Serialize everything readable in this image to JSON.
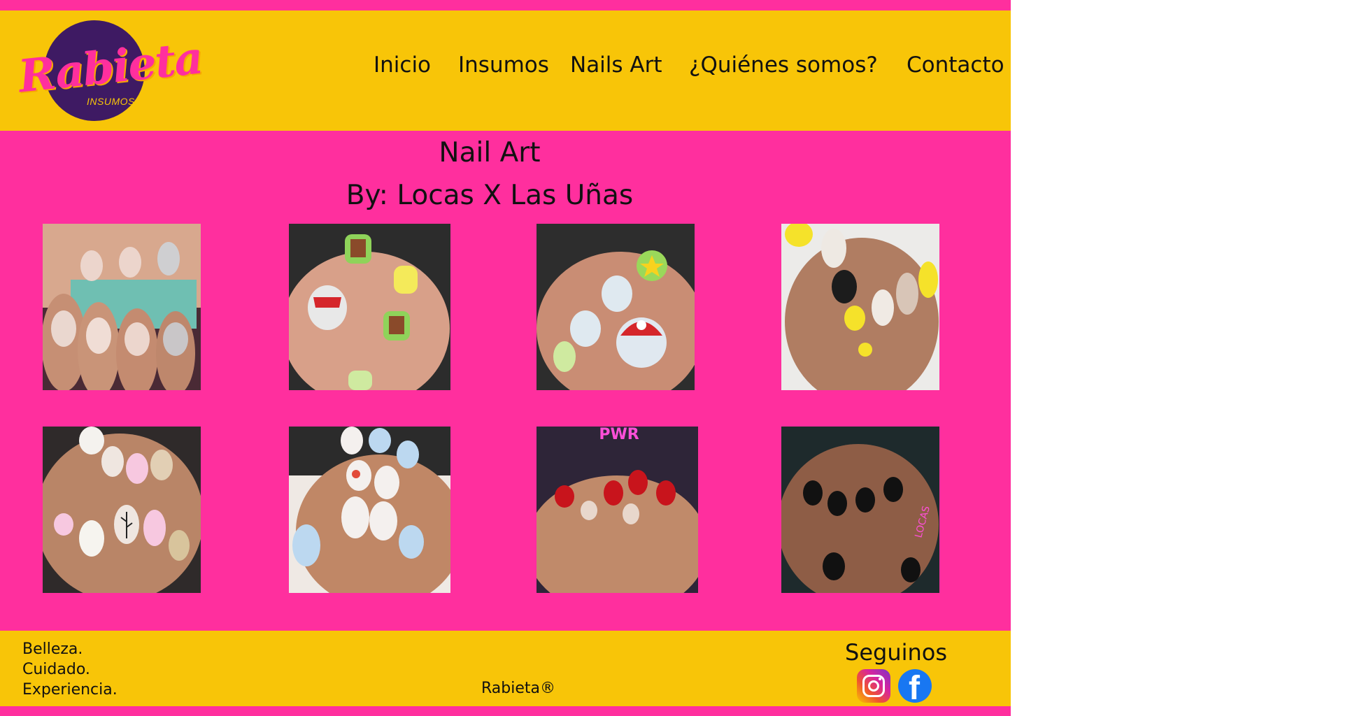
{
  "logo": {
    "text": "Rabieta",
    "subtext": "INSUMOS"
  },
  "nav": {
    "items": [
      {
        "label": "Inicio"
      },
      {
        "label": "Insumos"
      },
      {
        "label": "Nails Art"
      },
      {
        "label": "¿Quiénes somos?"
      },
      {
        "label": "Contacto"
      }
    ]
  },
  "main": {
    "title": "Nail Art",
    "subtitle": "By: Locas X Las Uñas",
    "gallery": [
      {
        "icon": "nail-photo-zebra-glitter"
      },
      {
        "icon": "nail-photo-mario-blocks"
      },
      {
        "icon": "nail-photo-mario-mushroom"
      },
      {
        "icon": "nail-photo-smiley-yellow"
      },
      {
        "icon": "nail-photo-leaves-pink"
      },
      {
        "icon": "nail-photo-floral-blue"
      },
      {
        "icon": "nail-photo-red-gems"
      },
      {
        "icon": "nail-photo-black-polish"
      }
    ]
  },
  "footer": {
    "tagline": [
      "Belleza.",
      "Cuidado.",
      "Experiencia."
    ],
    "brand": "Rabieta®",
    "follow_label": "Seguinos",
    "social": [
      {
        "icon": "instagram-icon"
      },
      {
        "icon": "facebook-icon"
      }
    ]
  },
  "colors": {
    "pink": "#ff2f9e",
    "yellow": "#f8c508",
    "purple": "#3e1a63",
    "instagram": "#d6249f",
    "facebook": "#1877f2"
  }
}
